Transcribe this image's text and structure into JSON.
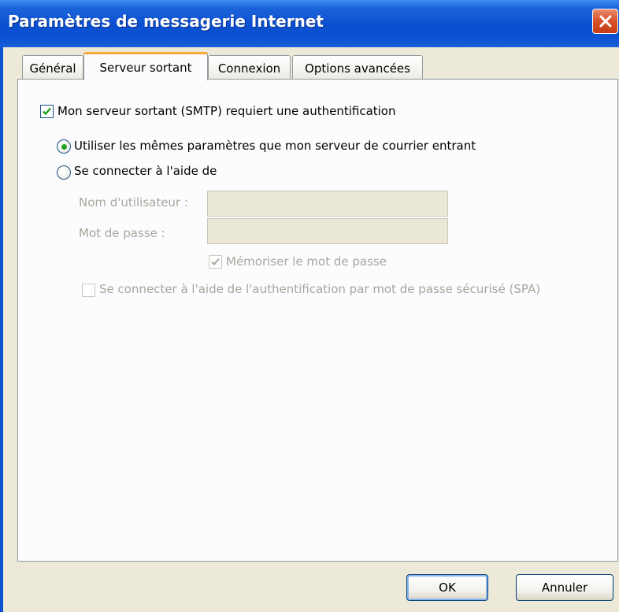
{
  "window": {
    "title": "Paramètres de messagerie Internet"
  },
  "tabs": [
    {
      "label": "Général"
    },
    {
      "label": "Serveur sortant"
    },
    {
      "label": "Connexion"
    },
    {
      "label": "Options avancées"
    }
  ],
  "active_tab": "Serveur sortant",
  "smtp_auth": {
    "label": "Mon serveur sortant (SMTP) requiert une authentification",
    "checked": true
  },
  "radio_same": {
    "label": "Utiliser les mêmes paramètres que mon serveur de courrier entrant",
    "selected": true
  },
  "radio_login": {
    "label": "Se connecter à l'aide de",
    "selected": false
  },
  "username": {
    "label": "Nom d'utilisateur :",
    "value": ""
  },
  "password": {
    "label": "Mot de passe :",
    "value": ""
  },
  "remember": {
    "label": "Mémoriser le mot de passe",
    "checked": true,
    "disabled": true
  },
  "spa": {
    "label": "Se connecter à l'aide de l'authentification par mot de passe sécurisé (SPA)",
    "checked": false,
    "disabled": true
  },
  "buttons": {
    "ok": "OK",
    "cancel": "Annuler"
  },
  "colors": {
    "titlebar": "#0b52d3",
    "close": "#d9532c",
    "dialog_bg": "#ece9d8",
    "active_tab_accent": "#f9a83b",
    "check": "#21a121"
  }
}
